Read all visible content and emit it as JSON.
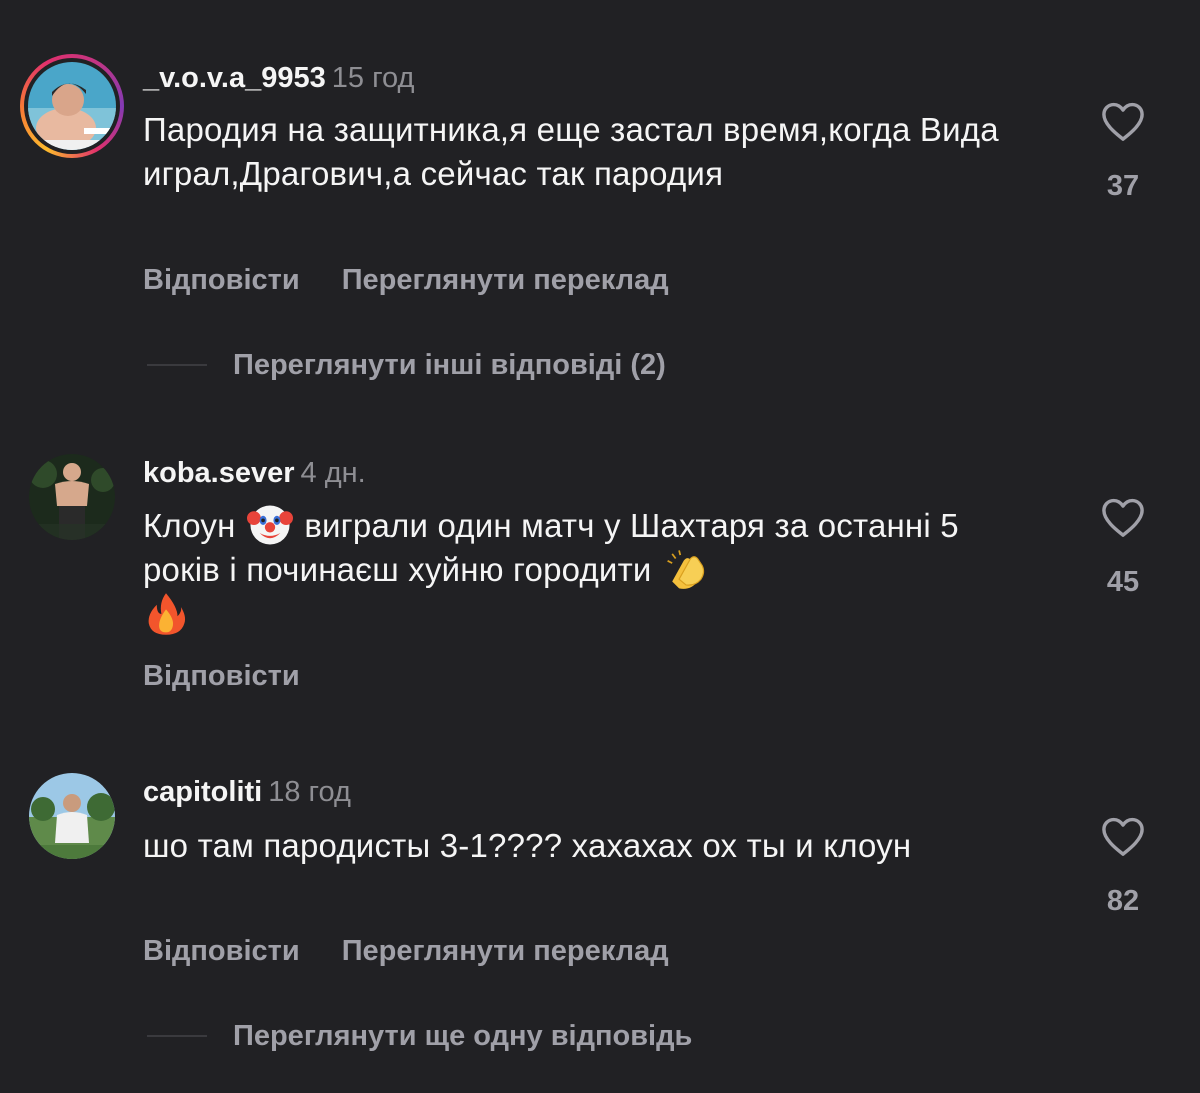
{
  "colors": {
    "background": "#212124",
    "primary_text": "#f5f5f5",
    "secondary_text": "#a0a0a8",
    "timestamp": "#8e8e93"
  },
  "comments": [
    {
      "username": "_v.o.v.a_9953",
      "time": "15 год",
      "avatar": "avatar-with-story-ring",
      "text": "Пародия на защитника,я еще застал время,когда Вида играл,Драгович,а сейчас так пародия",
      "likes": "37",
      "reply_label": "Відповісти",
      "translate_label": "Переглянути переклад",
      "more_replies_label": "Переглянути інші відповіді (2)"
    },
    {
      "username": "koba.sever",
      "time": "4 дн.",
      "avatar": "avatar",
      "text_parts": [
        "Клоун",
        "виграли один матч у Шахтаря за останні 5 років і починаєш хуйню городити"
      ],
      "emojis": [
        "clown-emoji",
        "clapping-hands-emoji",
        "fire-emoji"
      ],
      "likes": "45",
      "reply_label": "Відповісти"
    },
    {
      "username": "capitoliti",
      "time": "18 год",
      "avatar": "avatar",
      "text": "шо там пародисты 3-1???? хахахах ох ты и клоун",
      "likes": "82",
      "reply_label": "Відповісти",
      "translate_label": "Переглянути переклад",
      "more_replies_label": "Переглянути ще одну відповідь"
    }
  ]
}
